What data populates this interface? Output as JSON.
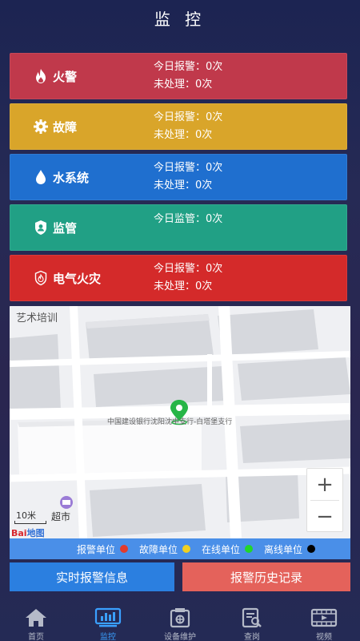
{
  "header": {
    "title": "监 控"
  },
  "cards": [
    {
      "name": "fire",
      "label": "火警",
      "color": "#c0394b",
      "lines": [
        "今日报警：0次",
        "未处理：0次"
      ]
    },
    {
      "name": "fault",
      "label": "故障",
      "color": "#d9a52a",
      "lines": [
        "今日报警：0次",
        "未处理：0次"
      ]
    },
    {
      "name": "water",
      "label": "水系统",
      "color": "#1f6fcf",
      "lines": [
        "今日报警：0次",
        "未处理：0次"
      ]
    },
    {
      "name": "supervision",
      "label": "监管",
      "color": "#21a085",
      "lines": [
        "今日监管：0次"
      ]
    },
    {
      "name": "electrical-fire",
      "label": "电气火灾",
      "color": "#d42a2a",
      "lines": [
        "今日报警：0次",
        "未处理：0次"
      ]
    }
  ],
  "map": {
    "label_top": "艺术培训",
    "poi_label": "中国建设银行沈阳沈中支行-白塔堡支行",
    "supermarket": "超市",
    "scale": "10米",
    "logo_a": "Bai",
    "logo_b": "地图",
    "zoom_in": "+",
    "zoom_out": "−"
  },
  "legend": [
    {
      "label": "报警单位",
      "color": "#e23b2c"
    },
    {
      "label": "故障单位",
      "color": "#f0d020"
    },
    {
      "label": "在线单位",
      "color": "#22d62a"
    },
    {
      "label": "离线单位",
      "color": "#000000"
    }
  ],
  "actions": {
    "realtime": "实时报警信息",
    "history": "报警历史记录"
  },
  "tabs": [
    {
      "label": "首页",
      "icon": "home-icon"
    },
    {
      "label": "监控",
      "icon": "monitor-icon",
      "active": true
    },
    {
      "label": "设备维护",
      "icon": "maintenance-icon"
    },
    {
      "label": "查岗",
      "icon": "inspection-icon"
    },
    {
      "label": "视频",
      "icon": "video-icon"
    }
  ]
}
